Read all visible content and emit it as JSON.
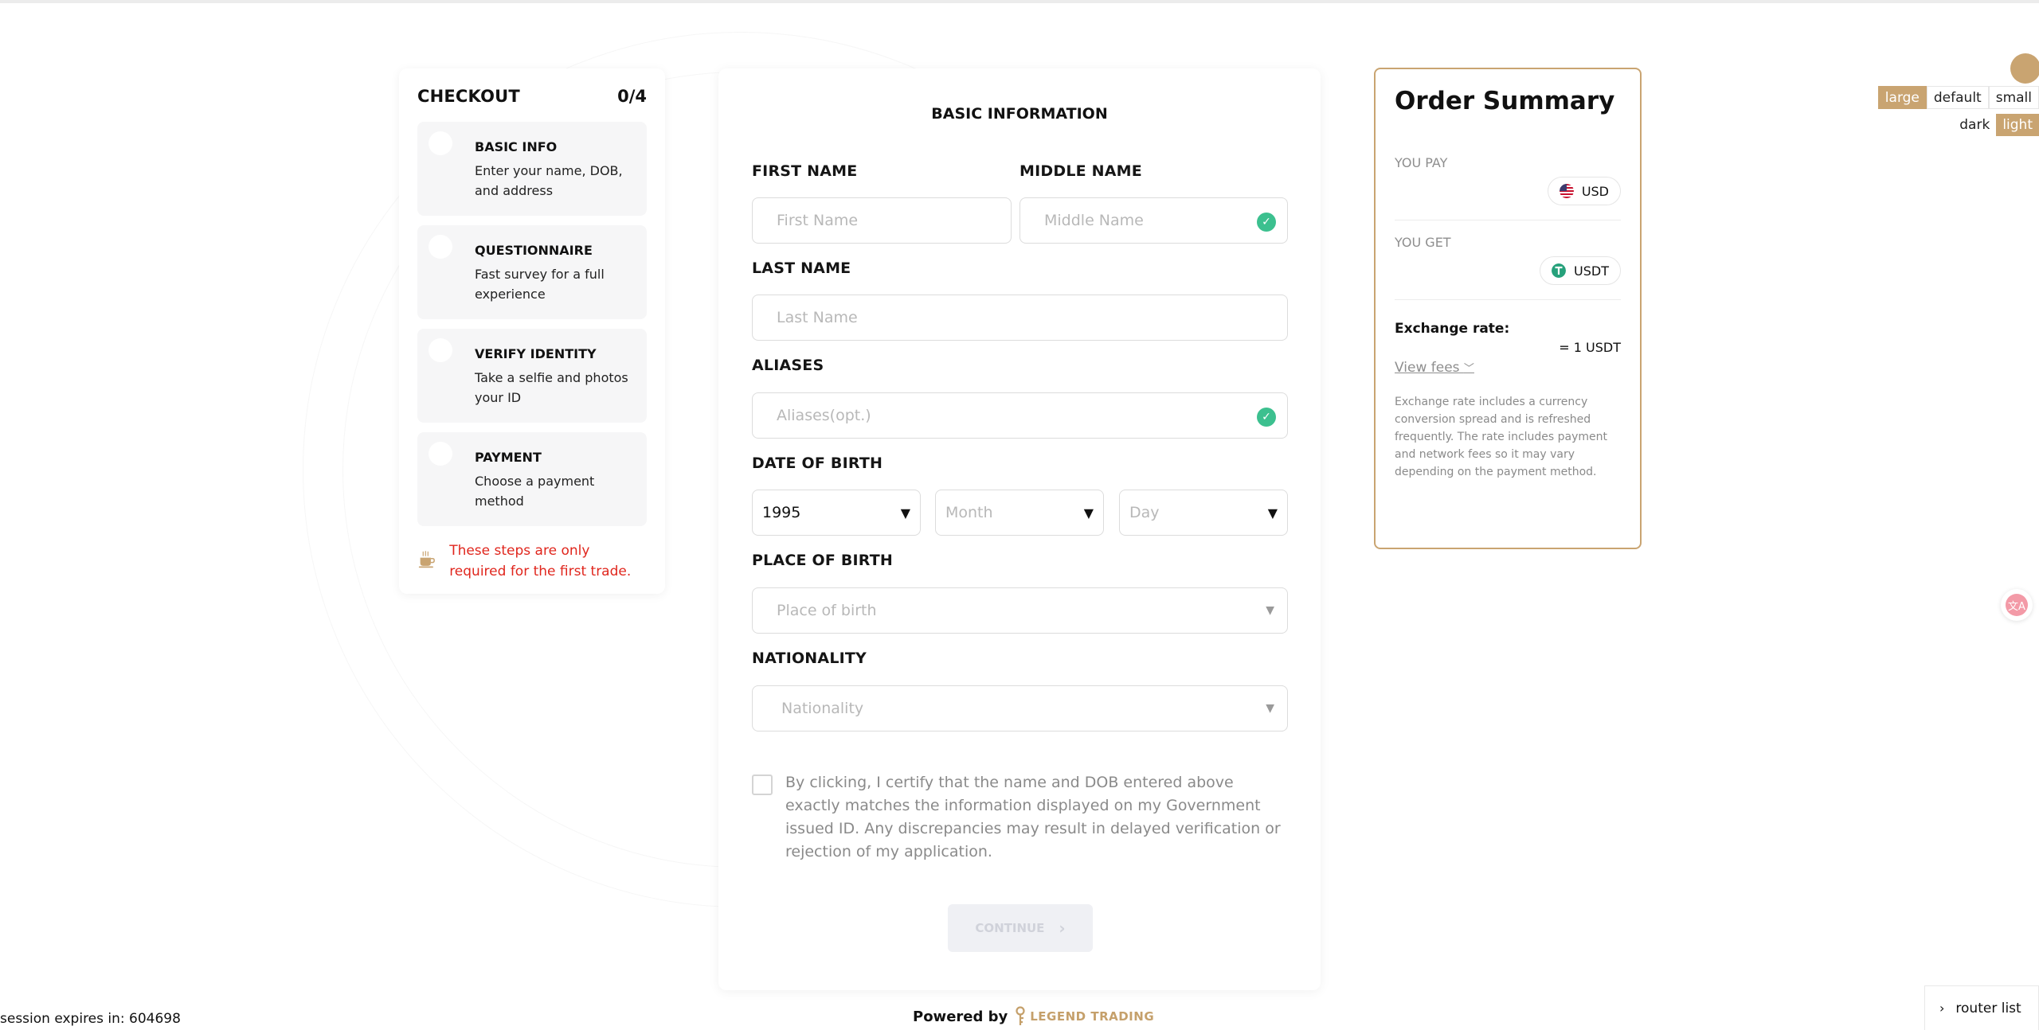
{
  "checkout": {
    "title": "CHECKOUT",
    "progress": "0/4",
    "steps": [
      {
        "title": "BASIC INFO",
        "desc": "Enter your name, DOB, and address"
      },
      {
        "title": "QUESTIONNAIRE",
        "desc": "Fast survey for a full experience"
      },
      {
        "title": "VERIFY IDENTITY",
        "desc": "Take a selfie and photos your ID"
      },
      {
        "title": "PAYMENT",
        "desc": "Choose a payment method"
      }
    ],
    "note": "These steps are only required for the first trade."
  },
  "form": {
    "title": "BASIC INFORMATION",
    "first_name": {
      "label": "FIRST NAME",
      "placeholder": "First Name"
    },
    "middle_name": {
      "label": "MIDDLE NAME",
      "placeholder": "Middle Name"
    },
    "last_name": {
      "label": "LAST NAME",
      "placeholder": "Last Name"
    },
    "aliases": {
      "label": "ALIASES",
      "placeholder": "Aliases(opt.)"
    },
    "dob": {
      "label": "DATE OF BIRTH",
      "year": "1995",
      "month": "Month",
      "day": "Day"
    },
    "place_of_birth": {
      "label": "PLACE OF BIRTH",
      "placeholder": "Place of birth"
    },
    "nationality": {
      "label": "NATIONALITY",
      "placeholder": "Nationality"
    },
    "certify_text": "By clicking, I certify that the name and DOB entered above exactly matches the information displayed on my Government issued ID. Any discrepancies may result in delayed verification or rejection of my application.",
    "continue_label": "CONTINUE"
  },
  "footer": {
    "powered_by": "Powered by",
    "brand": "LEGEND TRADING",
    "session": "session expires in: 604698"
  },
  "summary": {
    "title": "Order Summary",
    "you_pay_label": "YOU PAY",
    "pay_currency": "USD",
    "you_get_label": "YOU GET",
    "get_currency": "USDT",
    "exchange_label": "Exchange rate:",
    "exchange_value": "= 1 USDT",
    "view_fees": "View fees",
    "fees_note": "Exchange rate includes a currency conversion spread and is refreshed frequently. The rate includes payment and network fees so it may vary depending on the payment method."
  },
  "controls": {
    "sizes": [
      "large",
      "default",
      "small"
    ],
    "active_size": "large",
    "themes": [
      "dark",
      "light"
    ],
    "active_theme": "light",
    "router_label": "router list"
  },
  "colors": {
    "accent": "#c9a471",
    "error": "#e0261d",
    "success": "#3cc08f"
  }
}
